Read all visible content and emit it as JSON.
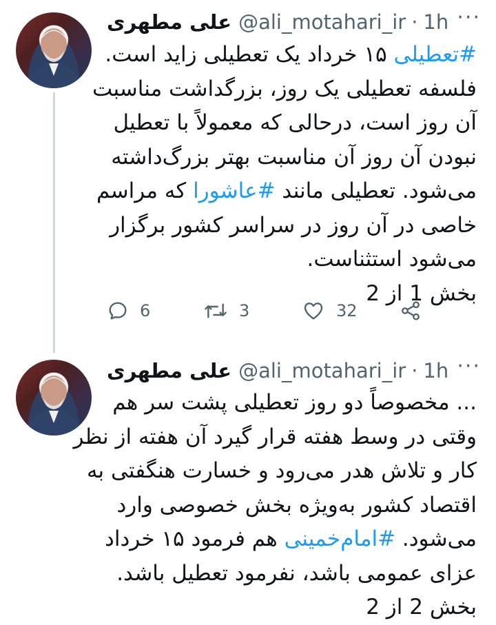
{
  "tweets": [
    {
      "author": {
        "name": "علی مطهری",
        "handle": "@ali_motahari_ir",
        "separator": "·",
        "time": "1h"
      },
      "lines": [
        [
          {
            "text": "#تعطیلی",
            "hashtag": true
          },
          {
            "text": " ۱۵ خرداد یک تعطیلی زاید است."
          }
        ],
        [
          {
            "text": "فلسفه تعطیلی یک روز، بزرگداشت مناسبت"
          }
        ],
        [
          {
            "text": "آن روز است، درحالی که معمولاً با تعطیل"
          }
        ],
        [
          {
            "text": "نبودن آن روز آن مناسبت بهتر بزرگ‌داشته"
          }
        ],
        [
          {
            "text": "می‌شود. تعطیلی مانند "
          },
          {
            "text": "#عاشورا",
            "hashtag": true
          },
          {
            "text": " که مراسم"
          }
        ],
        [
          {
            "text": "خاصی در آن روز در سراسر  کشور برگزار"
          }
        ],
        [
          {
            "text": "می‌شود استثناست."
          }
        ],
        [
          {
            "text": "بخش 1 از 2"
          }
        ]
      ],
      "actions": {
        "replies": "6",
        "retweets": "3",
        "likes": "32"
      },
      "more_icon": "more-dots-icon"
    },
    {
      "author": {
        "name": "علی مطهری",
        "handle": "@ali_motahari_ir",
        "separator": "·",
        "time": "1h"
      },
      "lines": [
        [
          {
            "text": "... مخصوصاً دو روز تعطیلی پشت سر هم"
          }
        ],
        [
          {
            "text": "وقتی در وسط هفته قرار گیرد آن هفته از نظر"
          }
        ],
        [
          {
            "text": "کار و تلاش هدر می‌رود و خسارت هنگفتی به"
          }
        ],
        [
          {
            "text": "اقتصاد کشور به‌ویژه بخش خصوصی وارد"
          }
        ],
        [
          {
            "text": "می‌شود. "
          },
          {
            "text": "#امام‌خمینی",
            "hashtag": true
          },
          {
            "text": " هم فرمود ۱۵ خرداد"
          }
        ],
        [
          {
            "text": "عزای عمومی باشد، نفرمود تعطیل باشد."
          }
        ],
        [
          {
            "text": "بخش 2 از 2"
          }
        ]
      ],
      "more_icon": "more-dots-icon"
    }
  ],
  "colors": {
    "hashtag": "#1d9bf0",
    "secondary_text": "#536471",
    "thread_line": "#cfd9de"
  }
}
